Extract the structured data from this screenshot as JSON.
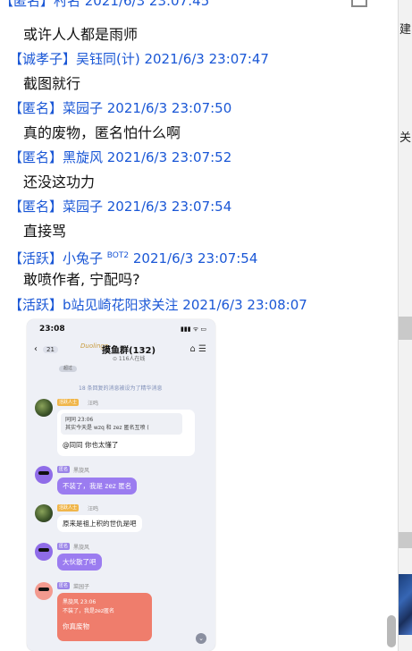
{
  "top_cut_text": "【匿名】村名 2021/6/3 23:07:45",
  "messages": [
    {
      "header": "",
      "body": "或许人人都是雨师"
    },
    {
      "header": "【诚孝子】吴钰同(计) 2021/6/3 23:07:47",
      "body": "截图就行"
    },
    {
      "header": "【匿名】菜园子 2021/6/3 23:07:50",
      "body": "真的废物，匿名怕什么啊"
    },
    {
      "header": "【匿名】黑旋风 2021/6/3 23:07:52",
      "body": "还没这功力"
    },
    {
      "header": "【匿名】菜园子 2021/6/3 23:07:54",
      "body": "直接骂"
    },
    {
      "header_pre": "【活跃】小兔子 ",
      "header_sup": "BOT2",
      "header_post": " 2021/6/3 23:07:54",
      "body": "敢喷作者, 宁配吗?"
    },
    {
      "header": "【活跃】b站见崎花阳求关注 2021/6/3 23:08:07"
    }
  ],
  "right_strip": {
    "label1": "建",
    "label2": "关"
  },
  "phone": {
    "time": "23:08",
    "signal": "▮▮▮ ᯤ ▭",
    "back_count": "21",
    "logo": "Duolingo",
    "group_title": "摸鱼群(132)",
    "online": "⊙ 116人在线",
    "icons": "⌂ ☰",
    "pill": "超过",
    "notice": "18 条回复的消息被设为了精华消息",
    "m1_tag": "活跃人士",
    "m1_name": "汪鸣",
    "m1_quote_line1": "同同 23:06",
    "m1_quote_line2": "其实今天是 wzq 和 zez 匿名互喷 (",
    "m1_text": "@同同 你也太懂了",
    "m2_tag": "匿名",
    "m2_name": "黑旋风",
    "m2_text": "不装了，我是 zez 匿名",
    "m3_tag": "活跃人士",
    "m3_name": "汪鸣",
    "m3_text": "原来是祖上积的世仇是吧",
    "m4_tag": "匿名",
    "m4_name": "黑旋风",
    "m4_text": "大伙散了吧",
    "m5_tag": "匿名",
    "m5_name": "菜园子",
    "m5_quote_line1": "黑旋风 23:06",
    "m5_quote_line2": "不装了，我是zez匿名",
    "m5_text": "你真废物",
    "down_arrow": "⌄"
  },
  "colors": {
    "header_blue": "#1a57d6",
    "purple_bubble": "#9b7cf0",
    "red_bubble": "#ef7d6c"
  }
}
